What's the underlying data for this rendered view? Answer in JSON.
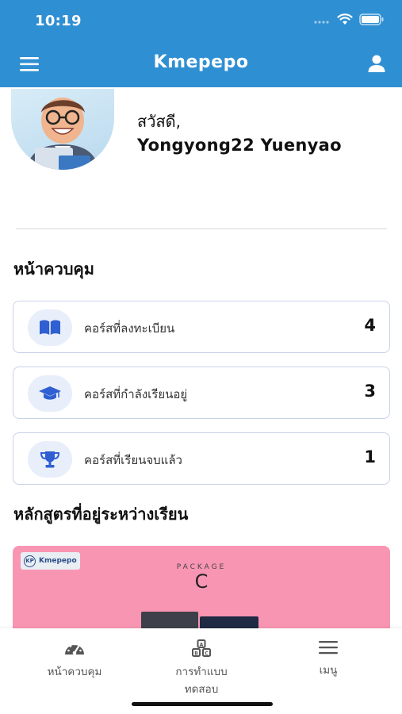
{
  "status_bar": {
    "time": "10:19"
  },
  "header": {
    "title": "Kmepepo",
    "menu_icon": "hamburger-icon",
    "profile_icon": "user-icon",
    "bg_color": "#2f8fd3"
  },
  "profile": {
    "greeting": "สวัสดี,",
    "name": "Yongyong22 Yuenyao"
  },
  "dashboard": {
    "title": "หน้าควบคุม",
    "stats": [
      {
        "label": "คอร์สที่ลงทะเบียน",
        "count": "4",
        "icon": "book-icon"
      },
      {
        "label": "คอร์สที่กำลังเรียนอยู่",
        "count": "3",
        "icon": "graduation-cap-icon"
      },
      {
        "label": "คอร์สที่เรียนจบแล้ว",
        "count": "1",
        "icon": "trophy-icon"
      }
    ],
    "icon_color": "#2f5fd1"
  },
  "in_progress": {
    "title": "หลักสูตรที่อยู่ระหว่างเรียน",
    "course": {
      "logo_mark": "KP",
      "logo_text": "Kmepepo",
      "package_label": "PACKAGE",
      "package_letter": "C",
      "bg_color": "#f895b2"
    }
  },
  "tabbar": {
    "items": [
      {
        "label": "หน้าควบคุม",
        "icon": "speedometer-icon"
      },
      {
        "label": "การทำแบบ\nทดสอบ",
        "icon": "blocks-icon"
      },
      {
        "label": "เมนู",
        "icon": "menu-icon"
      }
    ]
  }
}
